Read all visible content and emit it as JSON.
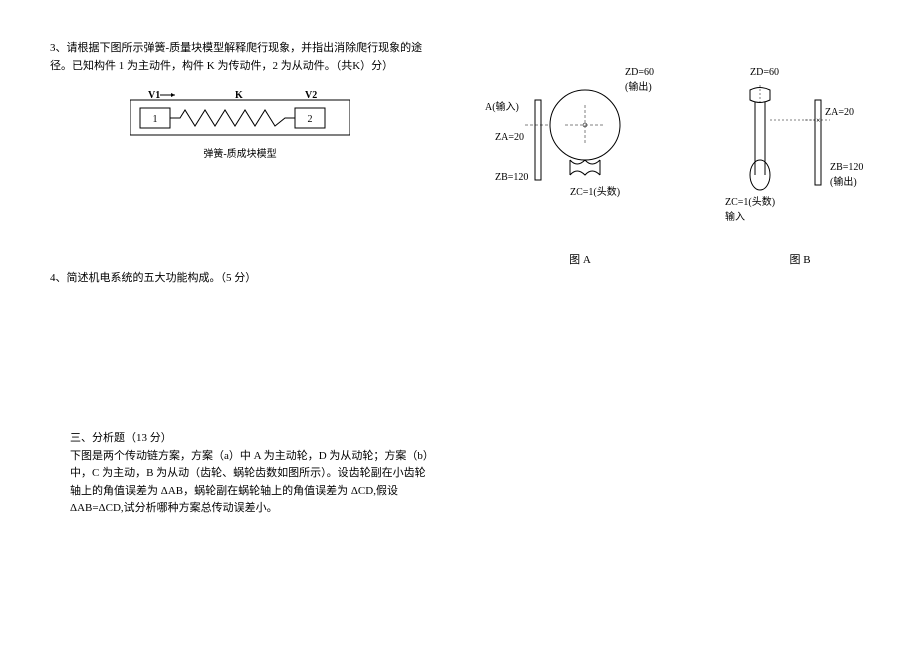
{
  "q3": {
    "text": "3、请根据下图所示弹簧-质量块模型解释爬行现象，并指出消除爬行现象的途径。已知构件 1 为主动件，构件 K 为传动件，2 为从动件。（共K）分）",
    "diagram": {
      "v1_label": "V1",
      "k_label": "K",
      "v2_label": "V2",
      "block1": "1",
      "block2": "2",
      "caption": "弹簧-质成块模型"
    }
  },
  "q4": {
    "text": "4、简述机电系统的五大功能构成。（5 分）"
  },
  "section3": {
    "title": "三、分析题（13 分）",
    "body": "下图是两个传动链方案，方案（a）中 A 为主动轮，D 为从动轮；方案（b）中，C 为主动，B 为从动（齿轮、蜗轮齿数如图所示）。设齿轮副在小齿轮轴上的角值误差为 ΔAB，蜗轮副在蜗轮轴上的角值误差为 ΔCD,假设 ΔAB=ΔCD,试分析哪种方案总传动误差小。"
  },
  "figA": {
    "a_input": "A(输入)",
    "za": "ZA=20",
    "zb": "ZB=120",
    "zd": "ZD=60",
    "output": "(输出)",
    "zc": "ZC=1(头数)",
    "label": "图 A"
  },
  "figB": {
    "zd": "ZD=60",
    "za": "ZA=20",
    "zb": "ZB=120",
    "output": "(输出)",
    "zc": "ZC=1(头数)",
    "input": "输入",
    "label": "图 B"
  },
  "chart_data": {
    "type": "diagram",
    "description": "Two transmission chain schemes with gear tooth counts",
    "scheme_A": {
      "ZA": 20,
      "ZB": 120,
      "ZC": 1,
      "ZD": 60,
      "driver": "A",
      "driven": "D"
    },
    "scheme_B": {
      "ZA": 20,
      "ZB": 120,
      "ZC": 1,
      "ZD": 60,
      "driver": "C",
      "driven": "B"
    }
  }
}
